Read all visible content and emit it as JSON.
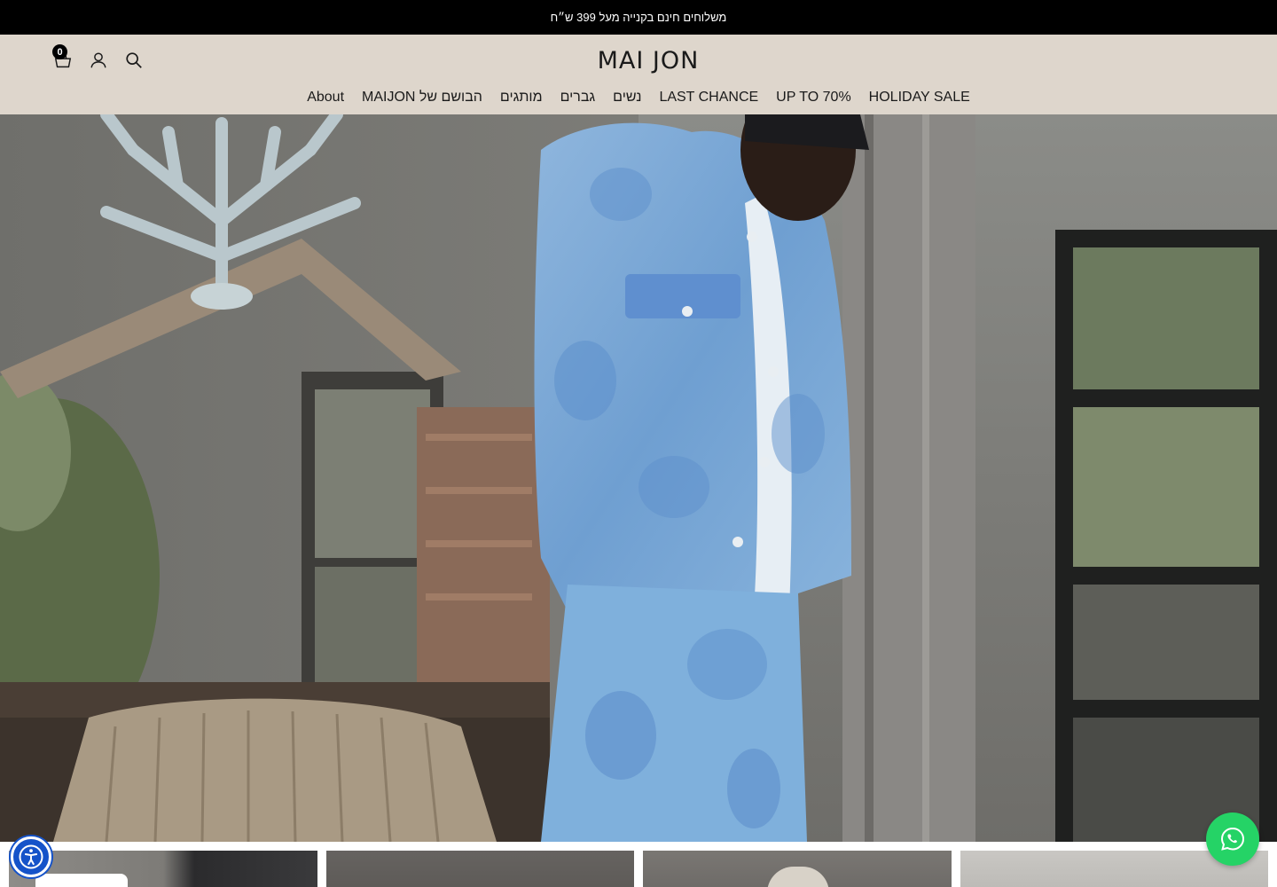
{
  "announcement": {
    "text": "משלוחים חינם בקנייה מעל 399 ש״ח"
  },
  "header": {
    "logo_text": "MAI JON",
    "cart_count": "0",
    "icons": [
      "cart-icon",
      "user-icon",
      "search-icon"
    ],
    "background": "#ded6cc"
  },
  "nav": {
    "items": [
      {
        "label": "HOLIDAY SALE"
      },
      {
        "label": "UP TO 70%"
      },
      {
        "label": "LAST CHANCE"
      },
      {
        "label": "נשים"
      },
      {
        "label": "גברים"
      },
      {
        "label": "מותגים"
      },
      {
        "label": "הבושם של MAIJON"
      },
      {
        "label": "About"
      }
    ]
  },
  "hero": {
    "description_icon": "hero-video"
  },
  "widgets": {
    "accessibility_icon": "accessibility-icon",
    "whatsapp_icon": "whatsapp-icon",
    "whatsapp_color": "#25d366",
    "accessibility_color": "#1553c9"
  }
}
